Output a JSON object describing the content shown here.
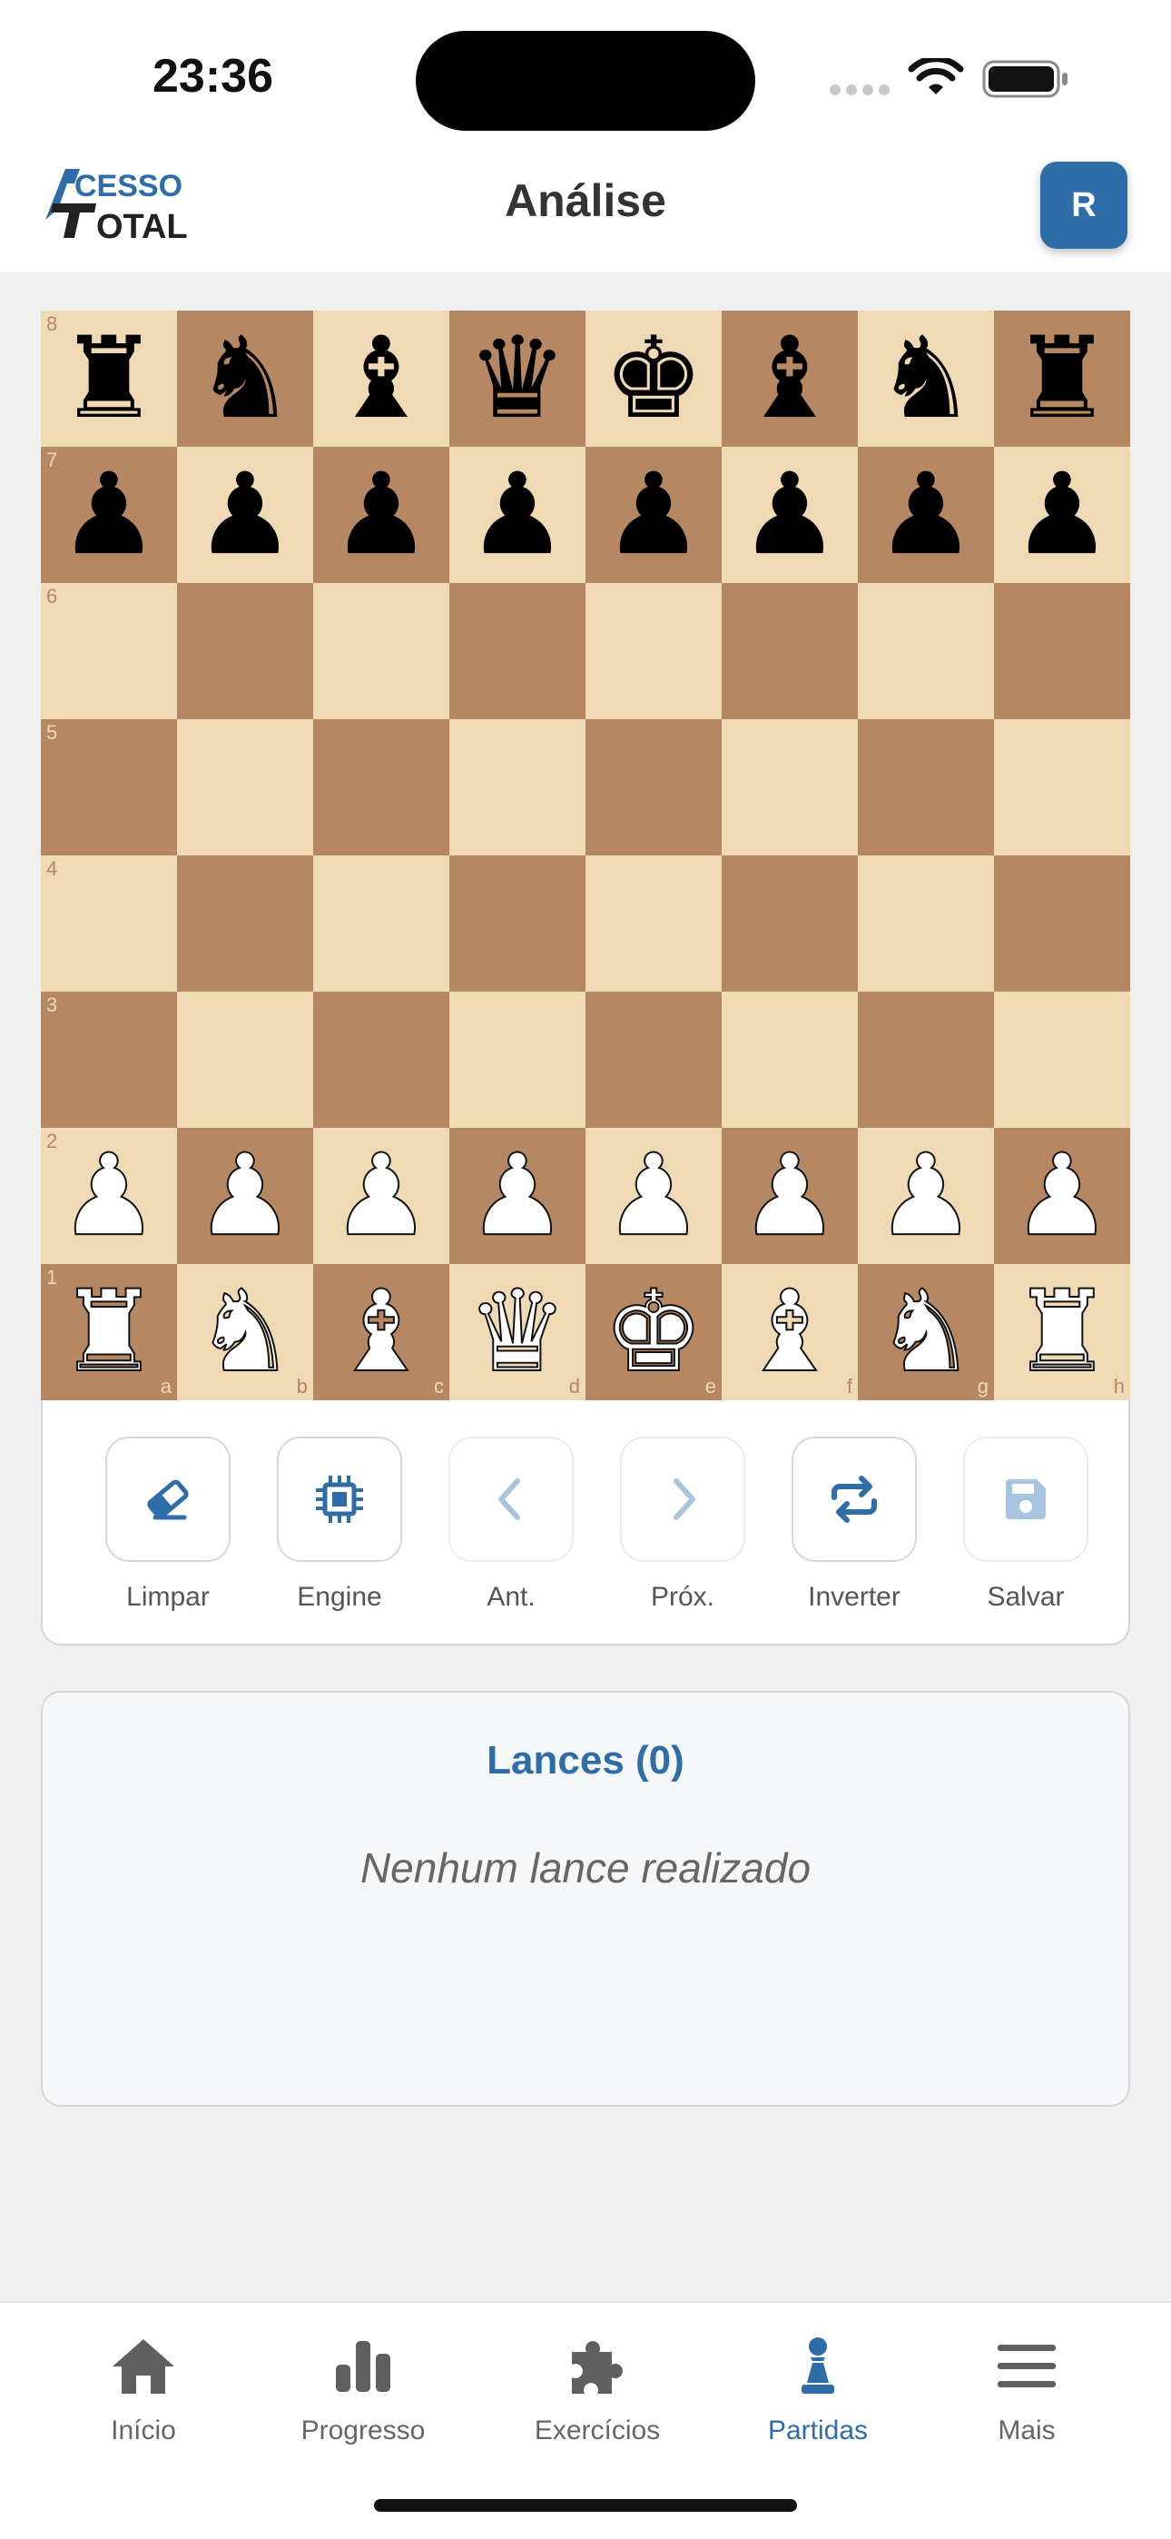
{
  "status": {
    "time": "23:36"
  },
  "header": {
    "logo_top": "ACESSO",
    "logo_bottom": "TOTAL",
    "title": "Análise",
    "avatar_initial": "R"
  },
  "board": {
    "rank_labels": [
      "8",
      "7",
      "6",
      "5",
      "4",
      "3",
      "2",
      "1"
    ],
    "file_labels": [
      "a",
      "b",
      "c",
      "d",
      "e",
      "f",
      "g",
      "h"
    ],
    "position": [
      [
        "bR",
        "bN",
        "bB",
        "bQ",
        "bK",
        "bB",
        "bN",
        "bR"
      ],
      [
        "bP",
        "bP",
        "bP",
        "bP",
        "bP",
        "bP",
        "bP",
        "bP"
      ],
      [
        "",
        "",
        "",
        "",
        "",
        "",
        "",
        ""
      ],
      [
        "",
        "",
        "",
        "",
        "",
        "",
        "",
        ""
      ],
      [
        "",
        "",
        "",
        "",
        "",
        "",
        "",
        ""
      ],
      [
        "",
        "",
        "",
        "",
        "",
        "",
        "",
        ""
      ],
      [
        "wP",
        "wP",
        "wP",
        "wP",
        "wP",
        "wP",
        "wP",
        "wP"
      ],
      [
        "wR",
        "wN",
        "wB",
        "wQ",
        "wK",
        "wB",
        "wN",
        "wR"
      ]
    ],
    "colors": {
      "light": "#f0d9b5",
      "dark": "#b58863"
    }
  },
  "controls": [
    {
      "label": "Limpar",
      "icon": "eraser-icon",
      "enabled": true
    },
    {
      "label": "Engine",
      "icon": "cpu-chip-icon",
      "enabled": true
    },
    {
      "label": "Ant.",
      "icon": "chevron-left-icon",
      "enabled": false
    },
    {
      "label": "Próx.",
      "icon": "chevron-right-icon",
      "enabled": false
    },
    {
      "label": "Inverter",
      "icon": "swap-arrows-icon",
      "enabled": true
    },
    {
      "label": "Salvar",
      "icon": "save-floppy-icon",
      "enabled": false
    }
  ],
  "moves": {
    "title": "Lances (0)",
    "empty_text": "Nenhum lance realizado"
  },
  "tabs": [
    {
      "label": "Início",
      "icon": "home-icon",
      "active": false
    },
    {
      "label": "Progresso",
      "icon": "bar-chart-icon",
      "active": false
    },
    {
      "label": "Exercícios",
      "icon": "puzzle-icon",
      "active": false
    },
    {
      "label": "Partidas",
      "icon": "chess-pawn-icon",
      "active": true
    },
    {
      "label": "Mais",
      "icon": "menu-icon",
      "active": false
    }
  ],
  "theme": {
    "accent": "#2e6da8",
    "disabled_icon": "#a9c4de"
  }
}
